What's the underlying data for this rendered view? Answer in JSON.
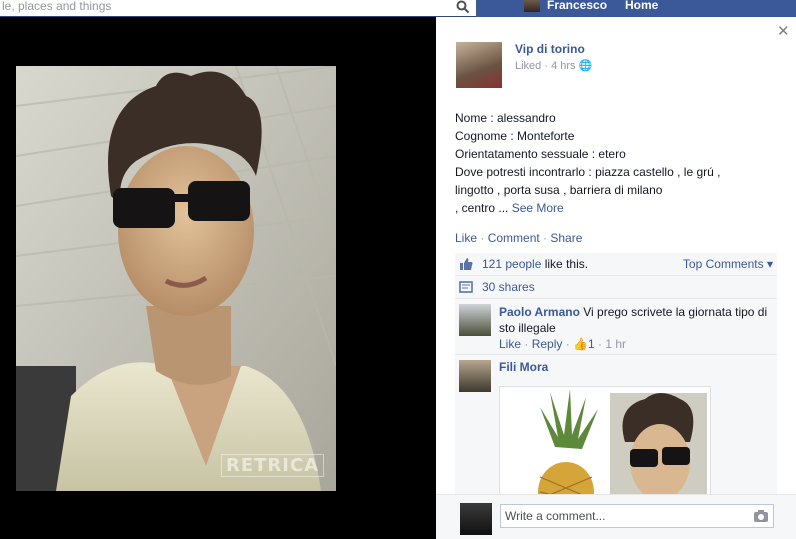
{
  "topbar": {
    "search_text": "le, places and things",
    "user_name": "Francesco",
    "home_label": "Home"
  },
  "photo": {
    "watermark": "RETRICA"
  },
  "post": {
    "page_name": "Vip di torino",
    "status": "Liked",
    "time": "4 hrs",
    "lines": [
      "Nome : alessandro",
      "Cognome : Monteforte",
      "Orientatamento sessuale : etero",
      "Dove potresti incontrarlo : piazza castello , le grú ,",
      "lingotto , porta susa , barriera di milano"
    ],
    "last_line": ", centro ...",
    "see_more": "See More",
    "actions": {
      "like": "Like",
      "comment": "Comment",
      "share": "Share"
    }
  },
  "ufi": {
    "likes_link": "121 people",
    "likes_suffix": " like this.",
    "top_comments": "Top Comments",
    "shares": "30 shares"
  },
  "comments": [
    {
      "author": "Paolo Armano",
      "text": "Vi prego scrivete la giornata tipo di sto illegale",
      "like": "Like",
      "reply": "Reply",
      "like_count": "1",
      "time": "1 hr"
    },
    {
      "author": "Fili Mora"
    }
  ],
  "compose": {
    "placeholder": "Write a comment..."
  }
}
